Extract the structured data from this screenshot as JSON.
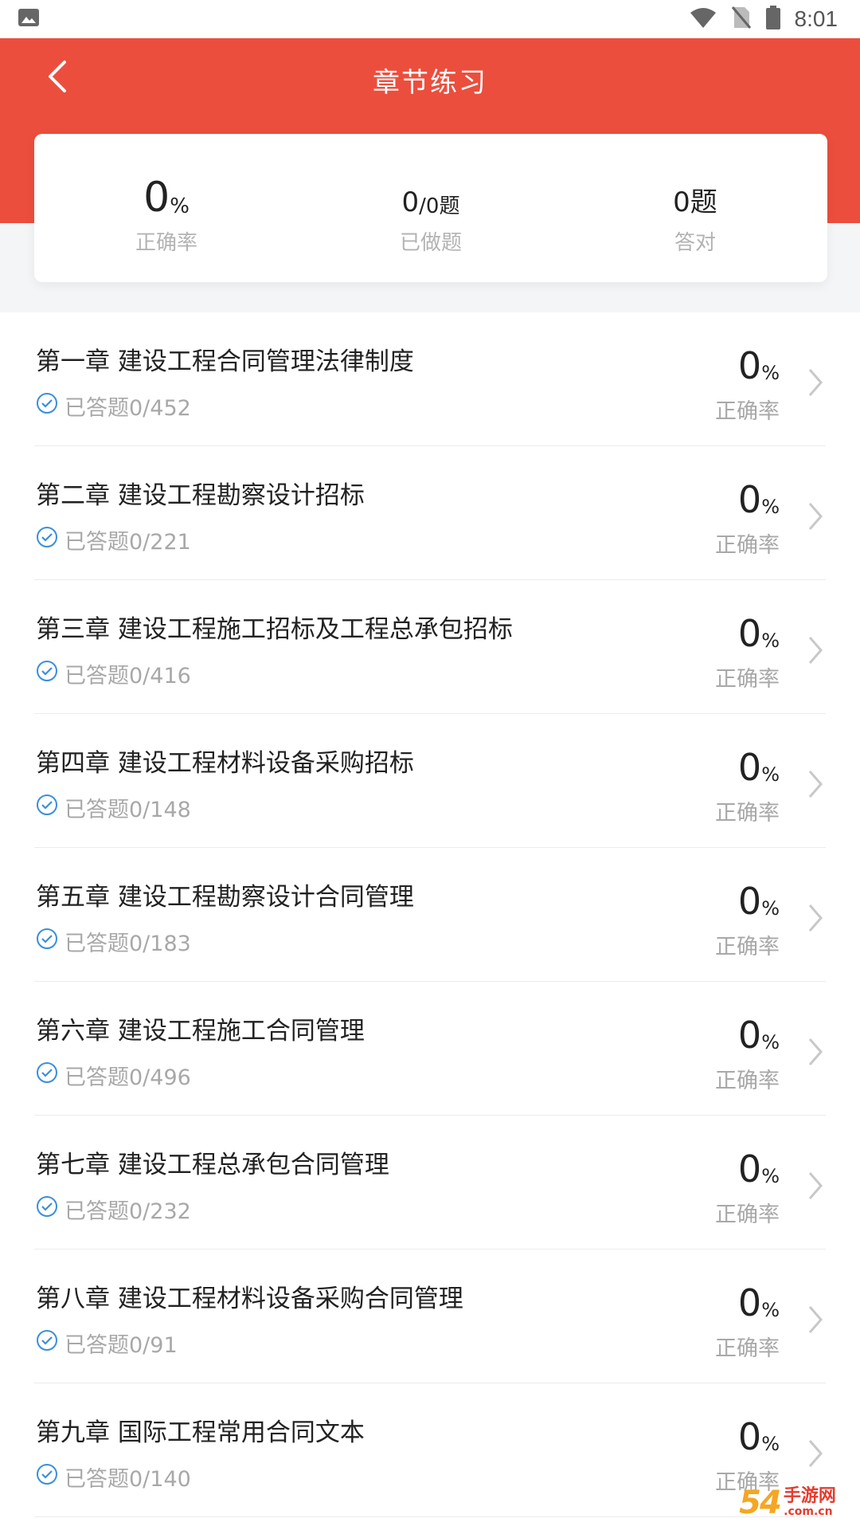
{
  "status_bar": {
    "time": "8:01"
  },
  "header": {
    "title": "章节练习"
  },
  "stats": {
    "accuracy": {
      "value": "0",
      "unit": "%",
      "label": "正确率"
    },
    "done": {
      "value": "0",
      "unit": "/0题",
      "label": "已做题"
    },
    "correct": {
      "value": "0题",
      "label": "答对"
    }
  },
  "chapters": [
    {
      "title": "第一章 建设工程合同管理法律制度",
      "answered": "已答题0/452",
      "rate": "0",
      "unit": "%",
      "rate_label": "正确率"
    },
    {
      "title": "第二章 建设工程勘察设计招标",
      "answered": "已答题0/221",
      "rate": "0",
      "unit": "%",
      "rate_label": "正确率"
    },
    {
      "title": "第三章 建设工程施工招标及工程总承包招标",
      "answered": "已答题0/416",
      "rate": "0",
      "unit": "%",
      "rate_label": "正确率"
    },
    {
      "title": "第四章 建设工程材料设备采购招标",
      "answered": "已答题0/148",
      "rate": "0",
      "unit": "%",
      "rate_label": "正确率"
    },
    {
      "title": "第五章 建设工程勘察设计合同管理",
      "answered": "已答题0/183",
      "rate": "0",
      "unit": "%",
      "rate_label": "正确率"
    },
    {
      "title": "第六章 建设工程施工合同管理",
      "answered": "已答题0/496",
      "rate": "0",
      "unit": "%",
      "rate_label": "正确率"
    },
    {
      "title": "第七章 建设工程总承包合同管理",
      "answered": "已答题0/232",
      "rate": "0",
      "unit": "%",
      "rate_label": "正确率"
    },
    {
      "title": "第八章 建设工程材料设备采购合同管理",
      "answered": "已答题0/91",
      "rate": "0",
      "unit": "%",
      "rate_label": "正确率"
    },
    {
      "title": "第九章 国际工程常用合同文本",
      "answered": "已答题0/140",
      "rate": "0",
      "unit": "%",
      "rate_label": "正确率"
    }
  ],
  "watermark": {
    "text_a": "54",
    "text_b": "手游网",
    "text_c": ".com.cn"
  },
  "colors": {
    "brand": "#ec4e3d",
    "check": "#3b8fd9"
  },
  "icons": [
    "image-icon",
    "wifi-icon",
    "no-sim-icon",
    "battery-icon",
    "back-arrow-icon",
    "check-circle-icon",
    "chevron-right-icon"
  ]
}
